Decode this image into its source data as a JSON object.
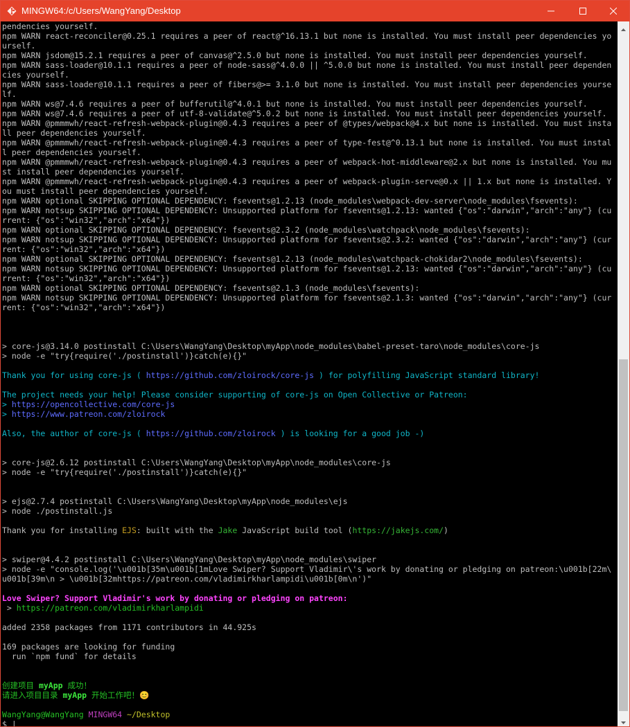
{
  "window": {
    "title": "MINGW64:/c/Users/WangYang/Desktop",
    "colors": {
      "titlebar": "#e5432b",
      "background": "#000000"
    }
  },
  "terminal": {
    "lines": [
      [
        {
          "t": "pendencies yourself.",
          "c": "default"
        }
      ],
      [
        {
          "t": "npm WARN react-reconciler@0.25.1 requires a peer of react@^16.13.1 but none is installed. You must install peer dependencies yo",
          "c": "default"
        }
      ],
      [
        {
          "t": "urself.",
          "c": "default"
        }
      ],
      [
        {
          "t": "npm WARN jsdom@15.2.1 requires a peer of canvas@^2.5.0 but none is installed. You must install peer dependencies yourself.",
          "c": "default"
        }
      ],
      [
        {
          "t": "npm WARN sass-loader@10.1.1 requires a peer of node-sass@^4.0.0 || ^5.0.0 but none is installed. You must install peer dependen",
          "c": "default"
        }
      ],
      [
        {
          "t": "cies yourself.",
          "c": "default"
        }
      ],
      [
        {
          "t": "npm WARN sass-loader@10.1.1 requires a peer of fibers@>= 3.1.0 but none is installed. You must install peer dependencies yourse",
          "c": "default"
        }
      ],
      [
        {
          "t": "lf.",
          "c": "default"
        }
      ],
      [
        {
          "t": "npm WARN ws@7.4.6 requires a peer of bufferutil@^4.0.1 but none is installed. You must install peer dependencies yourself.",
          "c": "default"
        }
      ],
      [
        {
          "t": "npm WARN ws@7.4.6 requires a peer of utf-8-validate@^5.0.2 but none is installed. You must install peer dependencies yourself.",
          "c": "default"
        }
      ],
      [
        {
          "t": "npm WARN @pmmmwh/react-refresh-webpack-plugin@0.4.3 requires a peer of @types/webpack@4.x but none is installed. You must insta",
          "c": "default"
        }
      ],
      [
        {
          "t": "ll peer dependencies yourself.",
          "c": "default"
        }
      ],
      [
        {
          "t": "npm WARN @pmmmwh/react-refresh-webpack-plugin@0.4.3 requires a peer of type-fest@^0.13.1 but none is installed. You must instal",
          "c": "default"
        }
      ],
      [
        {
          "t": "l peer dependencies yourself.",
          "c": "default"
        }
      ],
      [
        {
          "t": "npm WARN @pmmmwh/react-refresh-webpack-plugin@0.4.3 requires a peer of webpack-hot-middleware@2.x but none is installed. You mu",
          "c": "default"
        }
      ],
      [
        {
          "t": "st install peer dependencies yourself.",
          "c": "default"
        }
      ],
      [
        {
          "t": "npm WARN @pmmmwh/react-refresh-webpack-plugin@0.4.3 requires a peer of webpack-plugin-serve@0.x || 1.x but none is installed. Y",
          "c": "default"
        }
      ],
      [
        {
          "t": "ou must install peer dependencies yourself.",
          "c": "default"
        }
      ],
      [
        {
          "t": "npm WARN optional SKIPPING OPTIONAL DEPENDENCY: fsevents@1.2.13 (node_modules\\webpack-dev-server\\node_modules\\fsevents):",
          "c": "default"
        }
      ],
      [
        {
          "t": "npm WARN notsup SKIPPING OPTIONAL DEPENDENCY: Unsupported platform for fsevents@1.2.13: wanted {\"os\":\"darwin\",\"arch\":\"any\"} (cu",
          "c": "default"
        }
      ],
      [
        {
          "t": "rrent: {\"os\":\"win32\",\"arch\":\"x64\"})",
          "c": "default"
        }
      ],
      [
        {
          "t": "npm WARN optional SKIPPING OPTIONAL DEPENDENCY: fsevents@2.3.2 (node_modules\\watchpack\\node_modules\\fsevents):",
          "c": "default"
        }
      ],
      [
        {
          "t": "npm WARN notsup SKIPPING OPTIONAL DEPENDENCY: Unsupported platform for fsevents@2.3.2: wanted {\"os\":\"darwin\",\"arch\":\"any\"} (cur",
          "c": "default"
        }
      ],
      [
        {
          "t": "rent: {\"os\":\"win32\",\"arch\":\"x64\"})",
          "c": "default"
        }
      ],
      [
        {
          "t": "npm WARN optional SKIPPING OPTIONAL DEPENDENCY: fsevents@1.2.13 (node_modules\\watchpack-chokidar2\\node_modules\\fsevents):",
          "c": "default"
        }
      ],
      [
        {
          "t": "npm WARN notsup SKIPPING OPTIONAL DEPENDENCY: Unsupported platform for fsevents@1.2.13: wanted {\"os\":\"darwin\",\"arch\":\"any\"} (cu",
          "c": "default"
        }
      ],
      [
        {
          "t": "rrent: {\"os\":\"win32\",\"arch\":\"x64\"})",
          "c": "default"
        }
      ],
      [
        {
          "t": "npm WARN optional SKIPPING OPTIONAL DEPENDENCY: fsevents@2.1.3 (node_modules\\fsevents):",
          "c": "default"
        }
      ],
      [
        {
          "t": "npm WARN notsup SKIPPING OPTIONAL DEPENDENCY: Unsupported platform for fsevents@2.1.3: wanted {\"os\":\"darwin\",\"arch\":\"any\"} (cur",
          "c": "default"
        }
      ],
      [
        {
          "t": "rent: {\"os\":\"win32\",\"arch\":\"x64\"})",
          "c": "default"
        }
      ],
      [],
      [],
      [],
      [
        {
          "t": "> core-js@3.14.0 postinstall C:\\Users\\WangYang\\Desktop\\myApp\\node_modules\\babel-preset-taro\\node_modules\\core-js",
          "c": "default"
        }
      ],
      [
        {
          "t": "> node -e \"try{require('./postinstall')}catch(e){}\"",
          "c": "default"
        }
      ],
      [],
      [
        {
          "t": "Thank you for using core-js ( ",
          "c": "cyan"
        },
        {
          "t": "https://github.com/zloirock/core-js",
          "c": "link"
        },
        {
          "t": " ) for polyfilling JavaScript standard library!",
          "c": "cyan"
        }
      ],
      [],
      [
        {
          "t": "The project needs your help! Please consider supporting of core-js on Open Collective or Patreon:",
          "c": "cyan"
        }
      ],
      [
        {
          "t": "> ",
          "c": "cyan"
        },
        {
          "t": "https://opencollective.com/core-js",
          "c": "link"
        }
      ],
      [
        {
          "t": "> ",
          "c": "cyan"
        },
        {
          "t": "https://www.patreon.com/zloirock",
          "c": "link"
        }
      ],
      [],
      [
        {
          "t": "Also, the author of core-js ( ",
          "c": "cyan"
        },
        {
          "t": "https://github.com/zloirock",
          "c": "link"
        },
        {
          "t": " ) is looking for a good job -)",
          "c": "cyan"
        }
      ],
      [],
      [],
      [
        {
          "t": "> core-js@2.6.12 postinstall C:\\Users\\WangYang\\Desktop\\myApp\\node_modules\\core-js",
          "c": "default"
        }
      ],
      [
        {
          "t": "> node -e \"try{require('./postinstall')}catch(e){}\"",
          "c": "default"
        }
      ],
      [],
      [],
      [
        {
          "t": "> ejs@2.7.4 postinstall C:\\Users\\WangYang\\Desktop\\myApp\\node_modules\\ejs",
          "c": "default"
        }
      ],
      [
        {
          "t": "> node ./postinstall.js",
          "c": "default"
        }
      ],
      [],
      [
        {
          "t": "Thank you for installing ",
          "c": "default"
        },
        {
          "t": "EJS",
          "c": "ejs"
        },
        {
          "t": ": built with the ",
          "c": "default"
        },
        {
          "t": "Jake",
          "c": "ljs"
        },
        {
          "t": " JavaScript build tool (",
          "c": "default"
        },
        {
          "t": "https://jakejs.com/",
          "c": "ljs"
        },
        {
          "t": ")",
          "c": "default"
        }
      ],
      [],
      [],
      [
        {
          "t": "> swiper@4.4.2 postinstall C:\\Users\\WangYang\\Desktop\\myApp\\node_modules\\swiper",
          "c": "default"
        }
      ],
      [
        {
          "t": "> node -e \"console.log('\\u001b[35m\\u001b[1mLove Swiper? Support Vladimir\\'s work by donating or pledging on patreon:\\u001b[22m\\",
          "c": "default"
        }
      ],
      [
        {
          "t": "u001b[39m\\n > \\u001b[32mhttps://patreon.com/vladimirkharlampidi\\u001b[0m\\n')\"",
          "c": "default"
        }
      ],
      [],
      [
        {
          "t": "Love Swiper? Support Vladimir's work by donating or pledging on patreon:",
          "c": "magenta"
        }
      ],
      [
        {
          "t": " > ",
          "c": "default"
        },
        {
          "t": "https://patreon.com/vladimirkharlampidi",
          "c": "green"
        }
      ],
      [],
      [
        {
          "t": "added 2358 packages from 1171 contributors in 44.925s",
          "c": "default"
        }
      ],
      [],
      [
        {
          "t": "169 packages are looking for funding",
          "c": "default"
        }
      ],
      [
        {
          "t": "  run `npm fund` for details",
          "c": "default"
        }
      ],
      [],
      [],
      [
        {
          "t": "创建项目 ",
          "c": "green"
        },
        {
          "t": "myApp",
          "c": "green-bold"
        },
        {
          "t": " 成功！",
          "c": "green"
        }
      ],
      [
        {
          "t": "请进入项目目录 ",
          "c": "green"
        },
        {
          "t": "myApp",
          "c": "green-bold"
        },
        {
          "t": " 开始工作吧！😊",
          "c": "green"
        }
      ],
      [],
      [
        {
          "t": "WangYang@WangYang ",
          "c": "prompt-user"
        },
        {
          "t": "MINGW64",
          "c": "prompt-sys"
        },
        {
          "t": " ~/Desktop",
          "c": "prompt-path"
        }
      ],
      [
        {
          "t": "$ ",
          "c": "default"
        },
        {
          "t": "|",
          "c": "cursor"
        }
      ]
    ]
  }
}
